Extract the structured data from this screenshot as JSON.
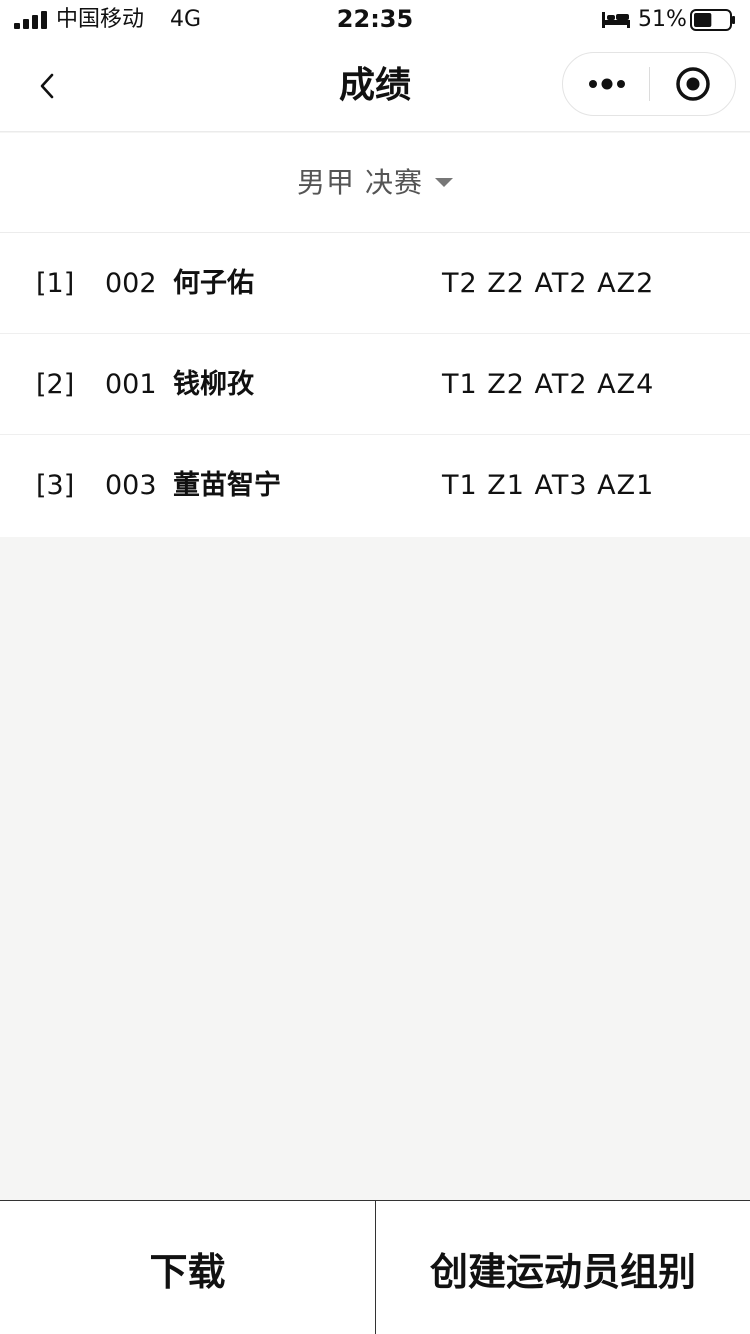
{
  "status_bar": {
    "carrier": "中国移动",
    "network": "4G",
    "time": "22:35",
    "battery_percent": "51%",
    "battery_level": 0.51
  },
  "nav": {
    "title": "成绩",
    "back_icon": "chevron-left-icon",
    "more_icon": "more-dots-icon",
    "close_icon": "target-close-icon"
  },
  "filter": {
    "label": "男甲 决赛",
    "icon": "caret-down-icon"
  },
  "results": [
    {
      "rank": "[1]",
      "bib": "002",
      "name": "何子佑",
      "score": "T2 Z2 AT2 AZ2"
    },
    {
      "rank": "[2]",
      "bib": "001",
      "name": "钱柳孜",
      "score": "T1 Z2 AT2 AZ4"
    },
    {
      "rank": "[3]",
      "bib": "003",
      "name": "董苗智宁",
      "score": "T1 Z1 AT3 AZ1"
    }
  ],
  "actions": {
    "download": "下载",
    "create_group": "创建运动员组别"
  },
  "colors": {
    "background": "#f5f5f4",
    "surface": "#ffffff",
    "text": "#111111",
    "muted_text": "#555555"
  }
}
